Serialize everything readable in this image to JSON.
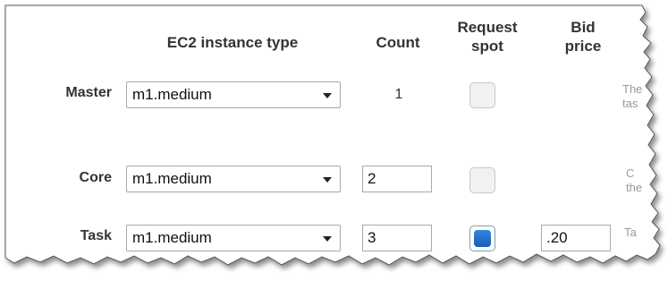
{
  "headers": {
    "instance_type": "EC2 instance type",
    "count": "Count",
    "request_spot_line1": "Request",
    "request_spot_line2": "spot",
    "bid_price_line1": "Bid",
    "bid_price_line2": "price"
  },
  "rows": [
    {
      "label": "Master",
      "instance_type": "m1.medium",
      "count": "1",
      "request_spot": false,
      "bid_price": "",
      "help_line1": "The",
      "help_line2": "tas"
    },
    {
      "label": "Core",
      "instance_type": "m1.medium",
      "count": "2",
      "request_spot": false,
      "bid_price": "",
      "help_line1": "C",
      "help_line2": "the"
    },
    {
      "label": "Task",
      "instance_type": "m1.medium",
      "count": "3",
      "request_spot": true,
      "bid_price": ".20",
      "help_line1": "Ta",
      "help_line2": ""
    }
  ],
  "colors": {
    "checkbox_checked": "#1a5fb4",
    "text_muted": "#999999",
    "header_text": "#333333"
  },
  "icons": {
    "select_arrow": "chevron-down-icon",
    "checkbox": "checkbox-icon"
  }
}
